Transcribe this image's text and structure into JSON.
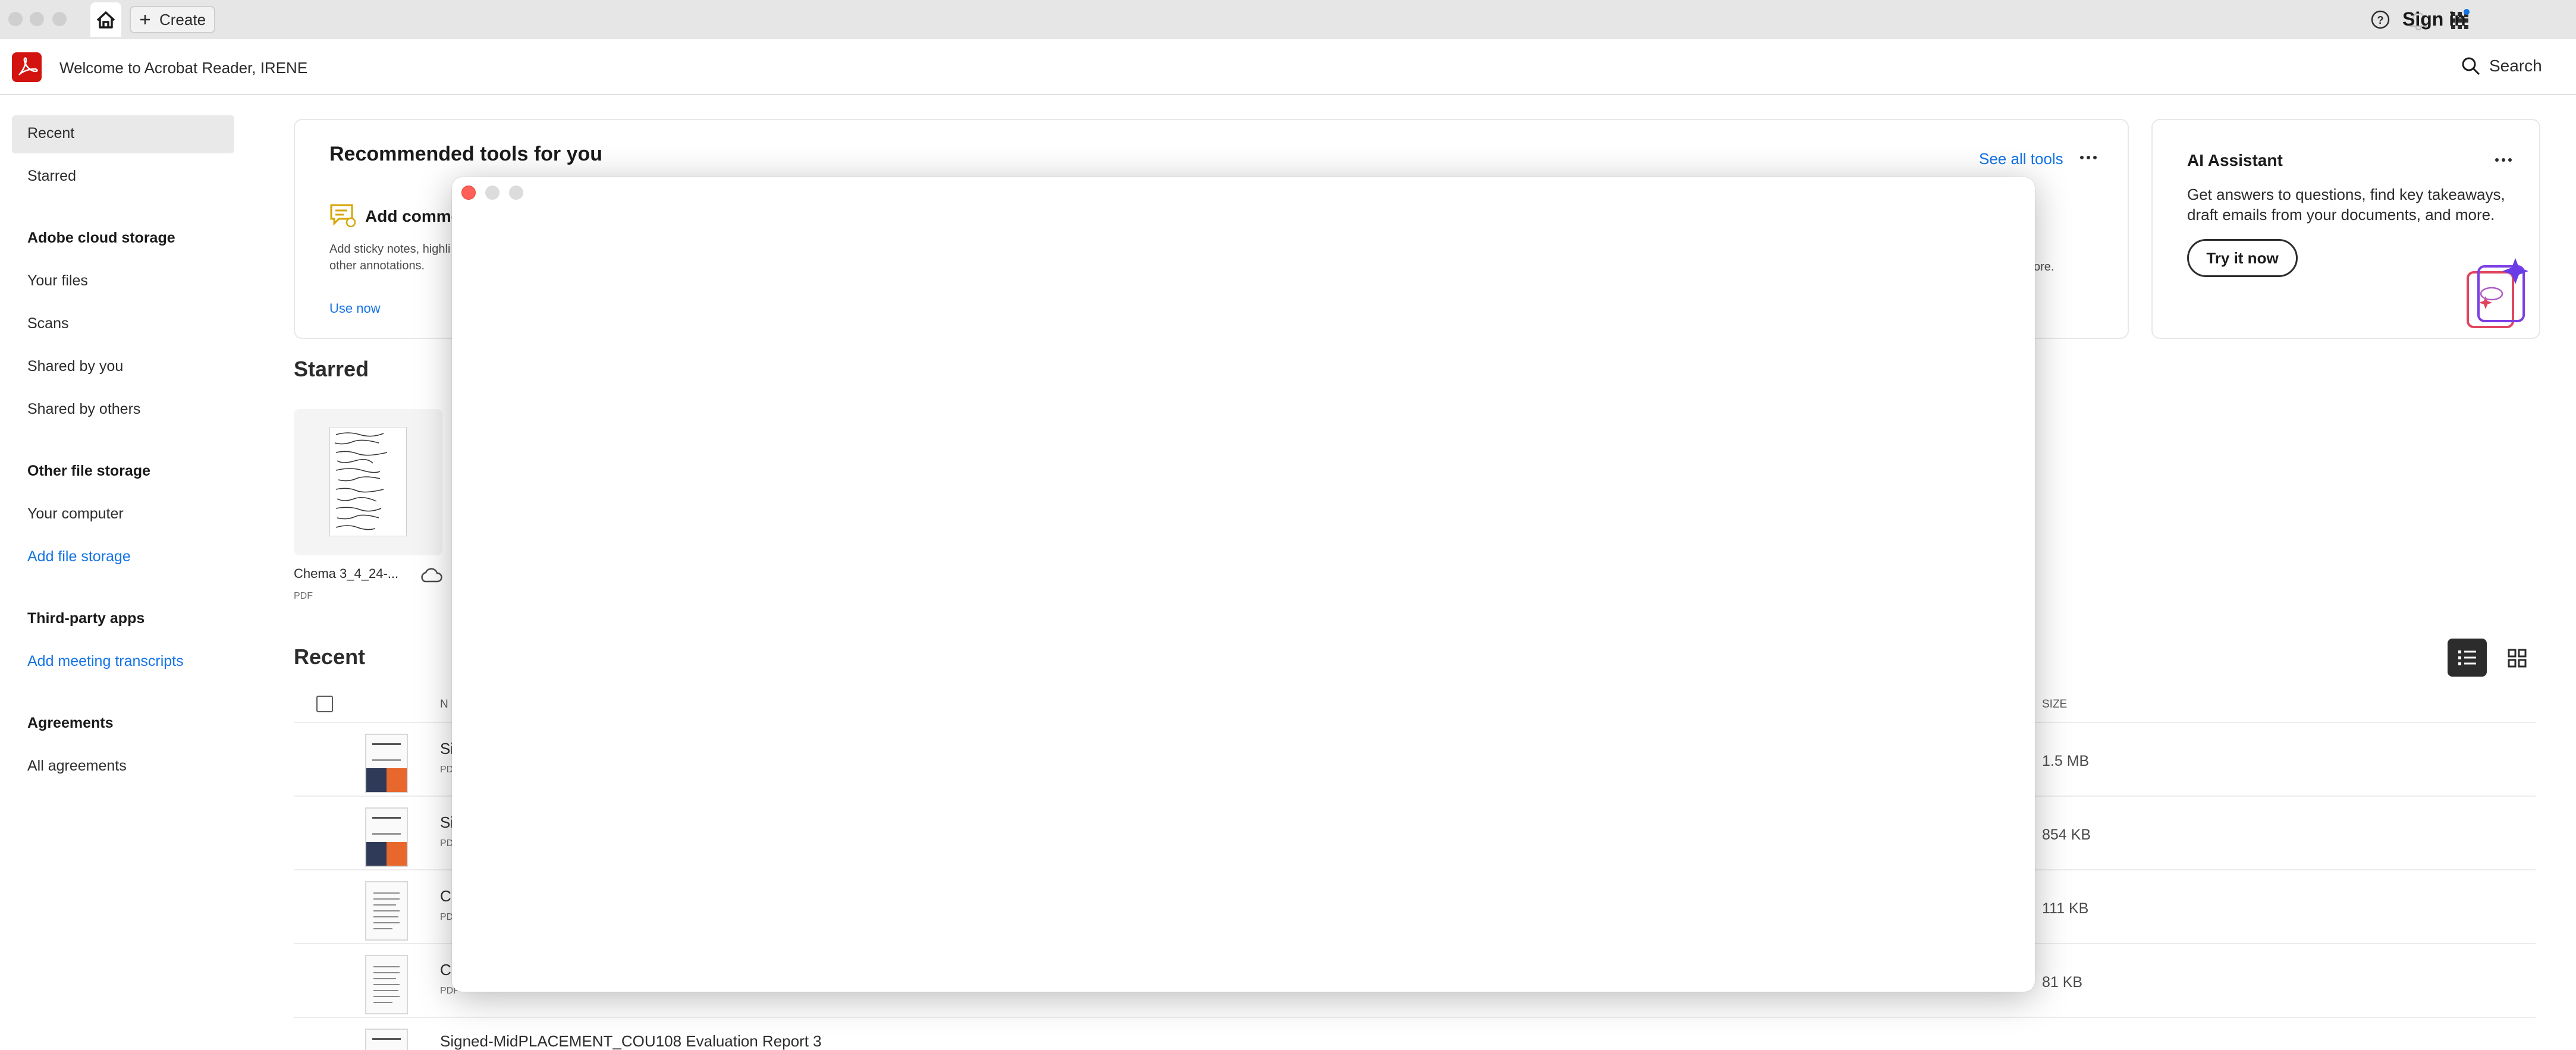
{
  "tabbar": {
    "create_label": "Create",
    "sign_in_label": "Sign in"
  },
  "header": {
    "welcome_text": "Welcome to Acrobat Reader, IRENE",
    "search_label": "Search"
  },
  "sidebar": {
    "recent": "Recent",
    "starred": "Starred",
    "cloud_heading": "Adobe cloud storage",
    "your_files": "Your files",
    "scans": "Scans",
    "shared_by_you": "Shared by you",
    "shared_by_others": "Shared by others",
    "other_heading": "Other file storage",
    "your_computer": "Your computer",
    "add_file_storage": "Add file storage",
    "third_party_heading": "Third-party apps",
    "add_meeting_transcripts": "Add meeting transcripts",
    "agreements_heading": "Agreements",
    "all_agreements": "All agreements"
  },
  "recommended": {
    "title": "Recommended tools for you",
    "see_all": "See all tools",
    "tool_title": "Add commen",
    "tool_desc_1": "Add sticky notes, highli",
    "tool_desc_2": "other annotations.",
    "tool_cta": "Use now",
    "overflow_text": "ore."
  },
  "ai": {
    "title": "AI Assistant",
    "desc_1": "Get answers to questions, find key takeaways,",
    "desc_2": "draft emails from your documents, and more.",
    "cta": "Try it now"
  },
  "starred_section": {
    "heading": "Starred",
    "file_name": "Chema 3_4_24-...",
    "file_type": "PDF"
  },
  "recent_section": {
    "heading": "Recent",
    "col_name": "N",
    "col_size": "SIZE",
    "rows": [
      {
        "name": "Si",
        "type": "PD",
        "size": "1.5 MB"
      },
      {
        "name": "Si",
        "type": "PD",
        "size": "854 KB"
      },
      {
        "name": "C",
        "type": "PD",
        "size": "111 KB"
      },
      {
        "name": "C",
        "type": "PDF",
        "size": "81 KB"
      },
      {
        "name": "Signed-MidPLACEMENT_COU108 Evaluation Report 3",
        "type": "",
        "size": ""
      }
    ]
  },
  "colors": {
    "accent_blue": "#1473e6",
    "acrobat_red": "#d2130f",
    "close_red": "#ff5f57"
  },
  "icons": {
    "home": "home-icon",
    "plus": "plus-icon",
    "help": "help-icon",
    "notification": "bell-icon",
    "apps": "apps-grid-icon",
    "search": "search-icon",
    "more": "more-horizontal-icon",
    "cloud": "cloud-icon",
    "list_view": "list-view-icon",
    "grid_view": "grid-view-icon"
  }
}
